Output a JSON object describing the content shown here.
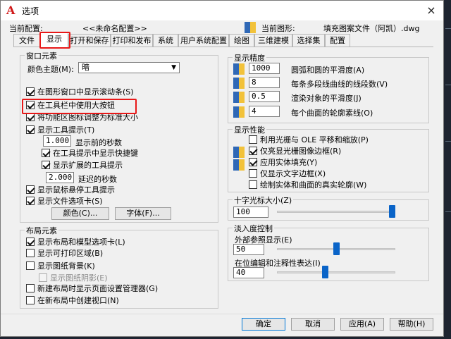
{
  "window": {
    "title": "选项",
    "close_glyph": "×"
  },
  "profile": {
    "current_config_label": "当前配置:",
    "current_config_value": "<<未命名配置>>",
    "current_drawing_label": "当前图形:",
    "current_drawing_value": "填充图案文件（阿凯）.dwg"
  },
  "tabs": [
    {
      "label": "文件"
    },
    {
      "label": "显示",
      "active": true
    },
    {
      "label": "打开和保存"
    },
    {
      "label": "打印和发布"
    },
    {
      "label": "系统"
    },
    {
      "label": "用户系统配置"
    },
    {
      "label": "绘图"
    },
    {
      "label": "三维建模"
    },
    {
      "label": "选择集"
    },
    {
      "label": "配置"
    }
  ],
  "window_elements": {
    "title": "窗口元素",
    "color_theme_label": "颜色主题(M):",
    "color_theme_value": "暗",
    "checks": [
      {
        "label": "在图形窗口中显示滚动条(S)",
        "checked": true
      },
      {
        "label": "在工具栏中使用大按钮",
        "checked": true
      },
      {
        "label": "将功能区图标调整为标准大小",
        "checked": true
      },
      {
        "label": "显示工具提示(T)",
        "checked": true
      }
    ],
    "tooltip_delay_value": "1.000",
    "tooltip_delay_label": "显示前的秒数",
    "show_shortcut_label": "在工具提示中显示快捷键",
    "show_extended_label": "显示扩展的工具提示",
    "extended_delay_value": "2.000",
    "extended_delay_label": "延迟的秒数",
    "rollover_label": "显示鼠标悬停工具提示",
    "file_tabs_label": "显示文件选项卡(S)",
    "colors_button": "颜色(C)...",
    "fonts_button": "字体(F)..."
  },
  "layout_elements": {
    "title": "布局元素",
    "checks": [
      {
        "label": "显示布局和模型选项卡(L)",
        "checked": true
      },
      {
        "label": "显示可打印区域(B)",
        "checked": false
      },
      {
        "label": "显示图纸背景(K)",
        "checked": false
      },
      {
        "label": "显示图纸阴影(E)",
        "checked": false,
        "disabled": true
      },
      {
        "label": "新建布局时显示页面设置管理器(G)",
        "checked": false
      },
      {
        "label": "在新布局中创建视口(N)",
        "checked": false
      }
    ]
  },
  "display_resolution": {
    "title": "显示精度",
    "rows": [
      {
        "value": "1000",
        "label": "圆弧和圆的平滑度(A)"
      },
      {
        "value": "8",
        "label": "每条多段线曲线的线段数(V)"
      },
      {
        "value": "0.5",
        "label": "渲染对象的平滑度(J)"
      },
      {
        "value": "4",
        "label": "每个曲面的轮廓素线(O)"
      }
    ]
  },
  "display_performance": {
    "title": "显示性能",
    "checks": [
      {
        "label": "利用光栅与 OLE 平移和缩放(P)",
        "checked": false
      },
      {
        "label": "仅亮显光栅图像边框(R)",
        "checked": true
      },
      {
        "label": "应用实体填充(Y)",
        "checked": true
      },
      {
        "label": "仅显示文字边框(X)",
        "checked": false
      },
      {
        "label": "绘制实体和曲面的真实轮廓(W)",
        "checked": false
      }
    ]
  },
  "crosshair": {
    "title": "十字光标大小(Z)",
    "value": "100",
    "level": 1.0
  },
  "fade_control": {
    "title": "淡入度控制",
    "xref_label": "外部参照显示(E)",
    "xref_value": "50",
    "xref_level": 0.5,
    "inplace_label": "在位编辑和注释性表达(I)",
    "inplace_value": "40",
    "inplace_level": 0.4
  },
  "footer": {
    "ok": "确定",
    "cancel": "取消",
    "apply": "应用(A)",
    "help": "帮助(H)"
  }
}
